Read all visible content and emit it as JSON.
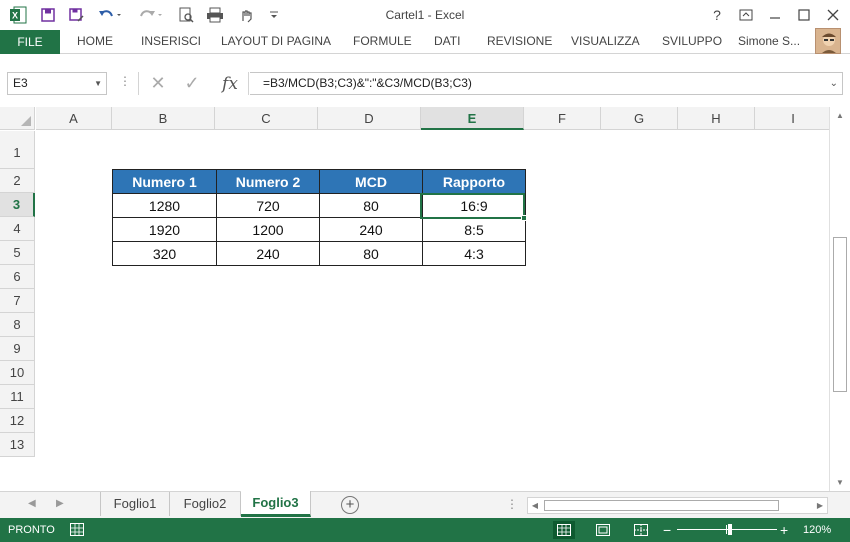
{
  "window": {
    "title": "Cartel1 - Excel"
  },
  "ribbon": {
    "file": "FILE",
    "tabs": [
      "HOME",
      "INSERISCI",
      "LAYOUT DI PAGINA",
      "FORMULE",
      "DATI",
      "REVISIONE",
      "VISUALIZZA",
      "SVILUPPO"
    ],
    "user": "Simone S..."
  },
  "formula_bar": {
    "name_box": "E3",
    "cancel_glyph": "✕",
    "enter_glyph": "✓",
    "fx": "fx",
    "formula": "=B3/MCD(B3;C3)&\":\"&C3/MCD(B3;C3)"
  },
  "grid": {
    "columns": [
      "A",
      "B",
      "C",
      "D",
      "E",
      "F",
      "G",
      "H",
      "I"
    ],
    "rows": [
      "1",
      "2",
      "3",
      "4",
      "5",
      "6",
      "7",
      "8",
      "9",
      "10",
      "11",
      "12",
      "13"
    ],
    "selected_column": "E",
    "selected_row": "3"
  },
  "table": {
    "headers": [
      "Numero 1",
      "Numero 2",
      "MCD",
      "Rapporto"
    ],
    "rows": [
      [
        "1280",
        "720",
        "80",
        "16:9"
      ],
      [
        "1920",
        "1200",
        "240",
        "8:5"
      ],
      [
        "320",
        "240",
        "80",
        "4:3"
      ]
    ],
    "header_color": "#2e75b6"
  },
  "sheets": {
    "tabs": [
      "Foglio1",
      "Foglio2",
      "Foglio3"
    ],
    "active": "Foglio3"
  },
  "status": {
    "text": "PRONTO",
    "zoom": "120%",
    "zoom_percent": 120
  },
  "colors": {
    "accent": "#217346",
    "table_header": "#2e75b6"
  },
  "icons": [
    "excel-logo-icon",
    "save-icon",
    "save-as-icon",
    "undo-icon",
    "redo-icon",
    "print-preview-icon",
    "print-icon",
    "touch-mode-icon",
    "help-icon",
    "ribbon-display-icon",
    "minimize-icon",
    "maximize-icon",
    "close-icon"
  ]
}
